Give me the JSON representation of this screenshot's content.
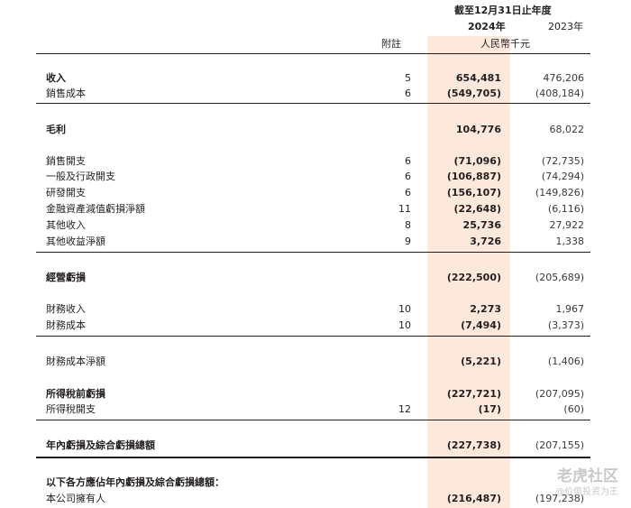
{
  "header": {
    "period": "截至12月31日止年度",
    "year_current": "2024年",
    "year_prior": "2023年",
    "note_col": "附註",
    "unit": "人民幣千元"
  },
  "rows": [
    {
      "label": "收入",
      "note": "5",
      "cur": "654,481",
      "prv": "476,206"
    },
    {
      "label": "銷售成本",
      "note": "6",
      "cur": "(549,705)",
      "prv": "(408,184)"
    },
    {
      "label": "毛利",
      "note": "",
      "cur": "104,776",
      "prv": "68,022"
    },
    {
      "label": "銷售開支",
      "note": "6",
      "cur": "(71,096)",
      "prv": "(72,735)"
    },
    {
      "label": "一般及行政開支",
      "note": "6",
      "cur": "(106,887)",
      "prv": "(74,294)"
    },
    {
      "label": "研發開支",
      "note": "6",
      "cur": "(156,107)",
      "prv": "(149,826)"
    },
    {
      "label": "金融資產減值虧損淨額",
      "note": "11",
      "cur": "(22,648)",
      "prv": "(6,116)"
    },
    {
      "label": "其他收入",
      "note": "8",
      "cur": "25,736",
      "prv": "27,922"
    },
    {
      "label": "其他收益淨額",
      "note": "9",
      "cur": "3,726",
      "prv": "1,338"
    },
    {
      "label": "經營虧損",
      "note": "",
      "cur": "(222,500)",
      "prv": "(205,689)"
    },
    {
      "label": "財務收入",
      "note": "10",
      "cur": "2,273",
      "prv": "1,967"
    },
    {
      "label": "財務成本",
      "note": "10",
      "cur": "(7,494)",
      "prv": "(3,373)"
    },
    {
      "label": "財務成本淨額",
      "note": "",
      "cur": "(5,221)",
      "prv": "(1,406)"
    },
    {
      "label": "所得稅前虧損",
      "note": "",
      "cur": "(227,721)",
      "prv": "(207,095)"
    },
    {
      "label": "所得稅開支",
      "note": "12",
      "cur": "(17)",
      "prv": "(60)"
    },
    {
      "label": "年內虧損及綜合虧損總額",
      "note": "",
      "cur": "(227,738)",
      "prv": "(207,155)"
    },
    {
      "label": "以下各方應佔年內虧損及綜合虧損總額：",
      "note": "",
      "cur": "",
      "prv": ""
    },
    {
      "label": "本公司擁有人",
      "note": "",
      "cur": "(216,487)",
      "prv": "(197,238)"
    }
  ],
  "watermark": {
    "brand": "老虎社区",
    "author": "@价值投资为王"
  }
}
